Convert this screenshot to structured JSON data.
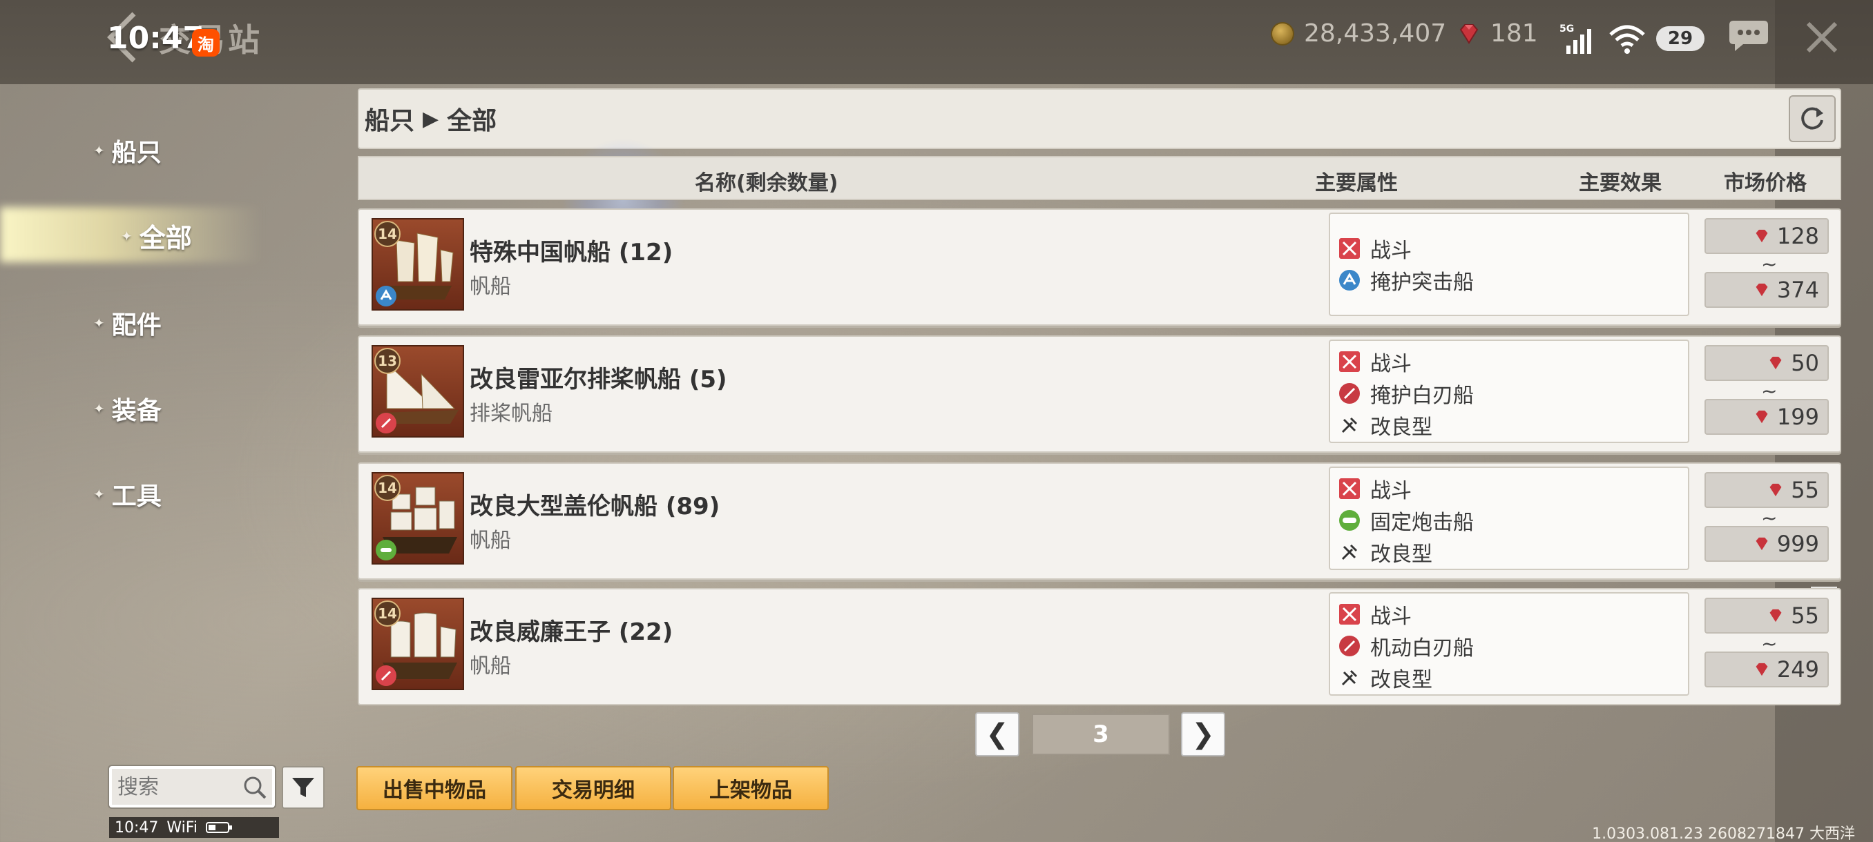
{
  "header": {
    "title": "交易站",
    "status_time": "10:47",
    "taobao_badge": "淘",
    "gold": "28,433,407",
    "gems": "181",
    "network": "5G",
    "battery": "29"
  },
  "nav": {
    "items": [
      {
        "label": "船只"
      },
      {
        "label": "全部"
      },
      {
        "label": "配件"
      },
      {
        "label": "装备"
      },
      {
        "label": "工具"
      }
    ]
  },
  "breadcrumb": {
    "category": "船只",
    "arrow": "▶",
    "sub": "全部"
  },
  "table": {
    "columns": {
      "name": "名称(剩余数量)",
      "attr": "主要属性",
      "effect": "主要效果",
      "price": "市场价格"
    },
    "rows": [
      {
        "level": "14",
        "name": "特殊中国帆船 (12)",
        "class": "帆船",
        "attr1": "战斗",
        "attr2": "掩护突击船",
        "attr3": "",
        "price_min": "128",
        "price_max": "374",
        "tilde": "~"
      },
      {
        "level": "13",
        "name": "改良雷亚尔排桨帆船 (5)",
        "class": "排桨帆船",
        "attr1": "战斗",
        "attr2": "掩护白刃船",
        "attr3": "改良型",
        "price_min": "50",
        "price_max": "199",
        "tilde": "~"
      },
      {
        "level": "14",
        "name": "改良大型盖伦帆船 (89)",
        "class": "帆船",
        "attr1": "战斗",
        "attr2": "固定炮击船",
        "attr3": "改良型",
        "price_min": "55",
        "price_max": "999",
        "tilde": "~"
      },
      {
        "level": "14",
        "name": "改良威廉王子 (22)",
        "class": "帆船",
        "attr1": "战斗",
        "attr2": "机动白刃船",
        "attr3": "改良型",
        "price_min": "55",
        "price_max": "249",
        "tilde": "~"
      }
    ]
  },
  "pagination": {
    "prev": "❮",
    "page": "3",
    "next": "❯"
  },
  "tabs": {
    "selling": "出售中物品",
    "history": "交易明细",
    "listed": "上架物品"
  },
  "search": {
    "placeholder": "搜索"
  },
  "bottom_status": {
    "time": "10:47",
    "wifi": "WiFi"
  },
  "version": "1.0303.081.23 2608271847 大西洋",
  "colors": {
    "tab_gold": "#f5b140",
    "gem_red": "#c8333b",
    "combat_red": "#d9434b",
    "cover_blue": "#3b87c9",
    "bombard_green": "#5fae3c"
  }
}
